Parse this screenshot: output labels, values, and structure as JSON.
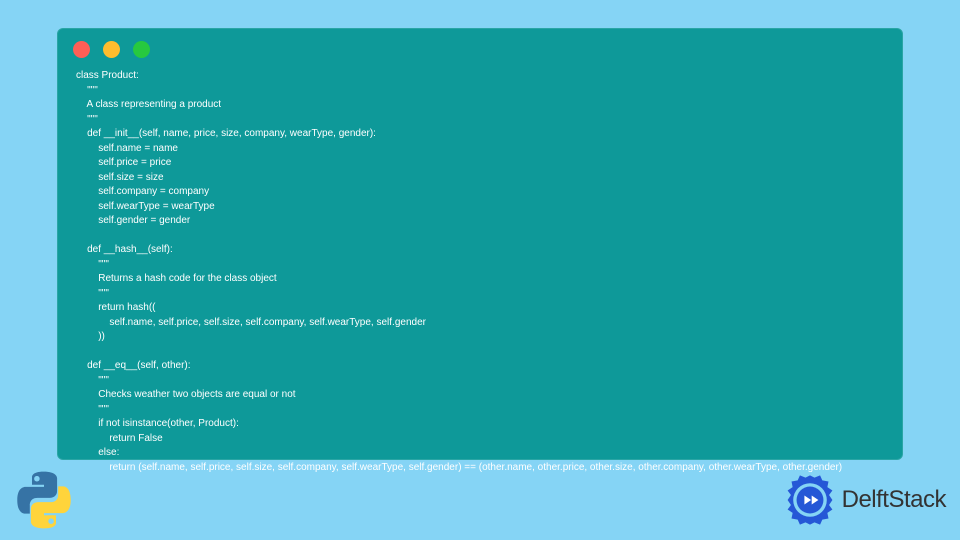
{
  "code": {
    "lines": [
      "class Product:",
      "    \"\"\"",
      "    A class representing a product",
      "    \"\"\"",
      "    def __init__(self, name, price, size, company, wearType, gender):",
      "        self.name = name",
      "        self.price = price",
      "        self.size = size",
      "        self.company = company",
      "        self.wearType = wearType",
      "        self.gender = gender",
      "",
      "    def __hash__(self):",
      "        \"\"\"",
      "        Returns a hash code for the class object",
      "        \"\"\"",
      "        return hash((",
      "            self.name, self.price, self.size, self.company, self.wearType, self.gender",
      "        ))",
      "",
      "    def __eq__(self, other):",
      "        \"\"\"",
      "        Checks weather two objects are equal or not",
      "        \"\"\"",
      "        if not isinstance(other, Product):",
      "            return False",
      "        else:",
      "            return (self.name, self.price, self.size, self.company, self.wearType, self.gender) == (other.name, other.price, other.size, other.company, other.wearType, other.gender)"
    ]
  },
  "brand": {
    "name": "DelftStack"
  }
}
